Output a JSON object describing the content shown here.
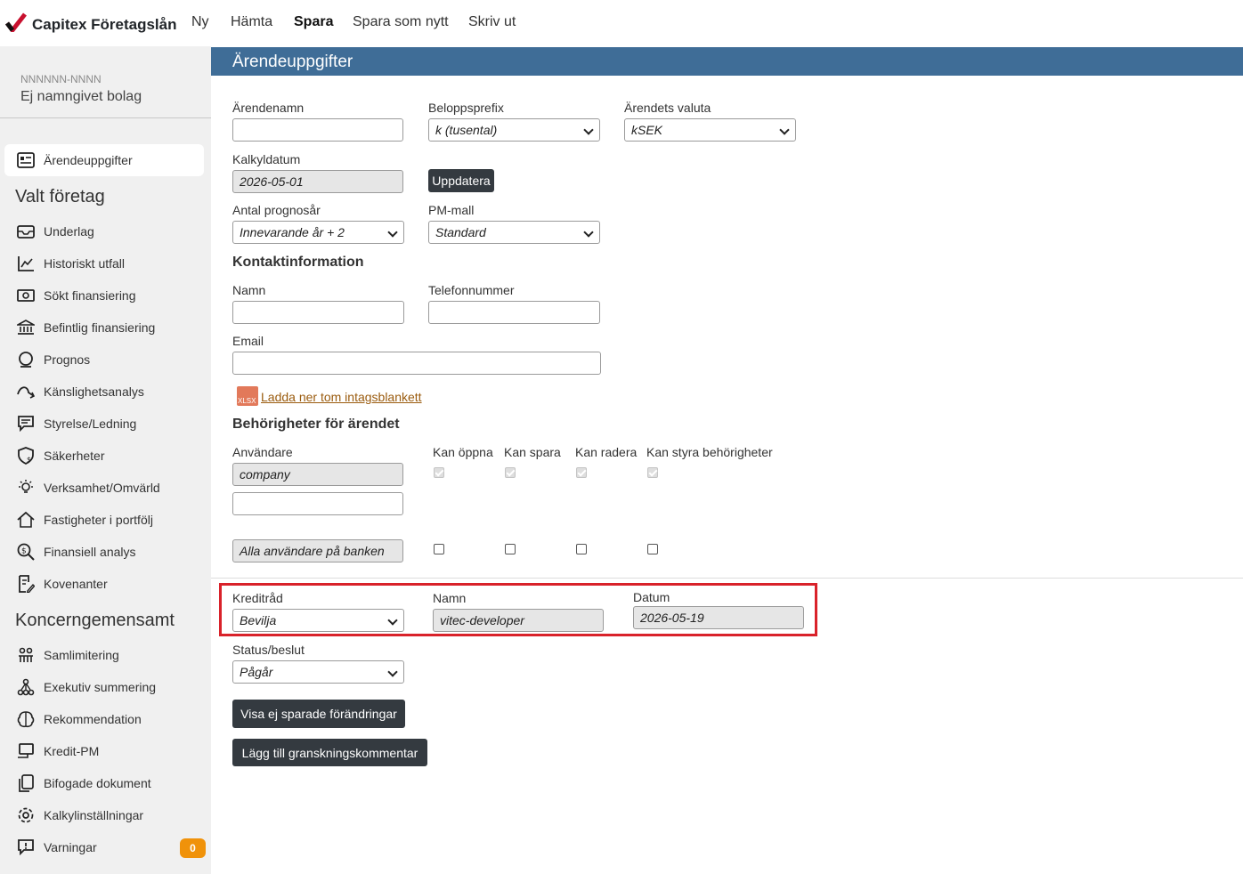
{
  "app": {
    "brand": "Capitex Företagslån",
    "nav": [
      "Ny",
      "Hämta",
      "Spara",
      "Spara som nytt",
      "Skriv ut"
    ]
  },
  "sidebar": {
    "company_id": "NNNNNN-NNNN",
    "company_name": "Ej namngivet bolag",
    "top_item": {
      "label": "Ärendeuppgifter",
      "icon": "id-card-icon"
    },
    "section1": "Valt företag",
    "items1": [
      {
        "label": "Underlag",
        "icon": "inbox-icon"
      },
      {
        "label": "Historiskt utfall",
        "icon": "chart-icon"
      },
      {
        "label": "Sökt finansiering",
        "icon": "money-icon"
      },
      {
        "label": "Befintlig finansiering",
        "icon": "bank-icon"
      },
      {
        "label": "Prognos",
        "icon": "crystal-ball-icon"
      },
      {
        "label": "Känslighetsanalys",
        "icon": "sensitivity-icon"
      },
      {
        "label": "Styrelse/Ledning",
        "icon": "board-icon"
      },
      {
        "label": "Säkerheter",
        "icon": "shield-dollar-icon"
      },
      {
        "label": "Verksamhet/Omvärld",
        "icon": "bulb-icon"
      },
      {
        "label": "Fastigheter i portfölj",
        "icon": "house-icon"
      },
      {
        "label": "Finansiell analys",
        "icon": "search-dollar-icon"
      },
      {
        "label": "Kovenanter",
        "icon": "document-edit-icon"
      }
    ],
    "section2": "Koncerngemensamt",
    "items2": [
      {
        "label": "Samlimitering",
        "icon": "group-icon"
      },
      {
        "label": "Exekutiv summering",
        "icon": "hierarchy-icon"
      },
      {
        "label": "Rekommendation",
        "icon": "brain-icon"
      },
      {
        "label": "Kredit-PM",
        "icon": "monitor-icon"
      },
      {
        "label": "Bifogade dokument",
        "icon": "files-icon"
      },
      {
        "label": "Kalkylinställningar",
        "icon": "settings-icon"
      },
      {
        "label": "Varningar",
        "icon": "warning-icon"
      }
    ],
    "warnings_count": "0"
  },
  "main": {
    "header": "Ärendeuppgifter",
    "labels": {
      "arendenamn": "Ärendenamn",
      "beloppsprefix": "Beloppsprefix",
      "valuta": "Ärendets valuta",
      "kalkyldatum": "Kalkyldatum",
      "prognosar": "Antal prognosår",
      "pm_mall": "PM-mall",
      "kontakt": "Kontaktinformation",
      "namn": "Namn",
      "telefon": "Telefonnummer",
      "email": "Email",
      "behorigheter": "Behörigheter för ärendet",
      "anvandare": "Användare",
      "kan_oppna": "Kan öppna",
      "kan_spara": "Kan spara",
      "kan_radera": "Kan radera",
      "kan_styra": "Kan styra behörigheter",
      "kreditrad": "Kreditråd",
      "namn2": "Namn",
      "datum": "Datum",
      "status": "Status/beslut"
    },
    "values": {
      "arendenamn": "",
      "beloppsprefix": "k (tusental)",
      "valuta": "kSEK",
      "kalkyldatum": "2026-05-01",
      "prognosar": "Innevarande år + 2",
      "pm_mall": "Standard",
      "namn": "",
      "telefon": "",
      "email": "",
      "user1": "company",
      "user2": "",
      "all_users": "Alla användare på banken",
      "kreditrad": "Bevilja",
      "kreditrad_namn": "vitec-developer",
      "kreditrad_datum": "2026-05-19",
      "status": "Pågår"
    },
    "buttons": {
      "update": "Uppdatera",
      "show_changes": "Visa ej sparade förändringar",
      "add_comment": "Lägg till granskningskommentar"
    },
    "download": {
      "icon_text": "XLSX",
      "link": "Ladda ner tom intagsblankett"
    }
  }
}
